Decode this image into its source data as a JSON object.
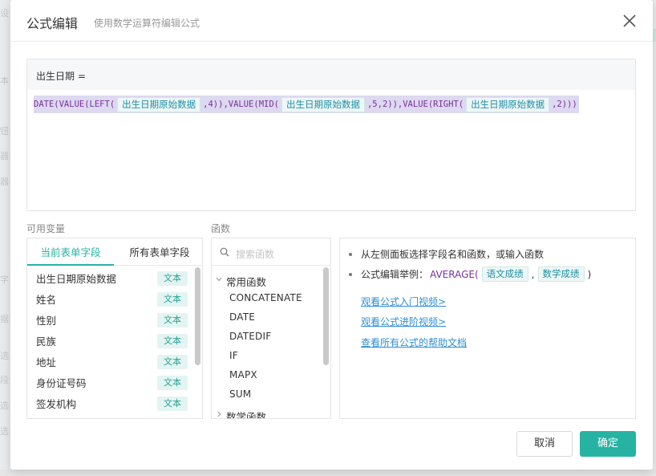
{
  "background": {
    "left_fragments": [
      "设",
      "本",
      "钮",
      "器",
      "器",
      "字",
      "据",
      "选",
      "段",
      "选",
      "选"
    ]
  },
  "dialog": {
    "title": "公式编辑",
    "subtitle": "使用数学运算符编辑公式",
    "close_icon": "close-icon"
  },
  "editor": {
    "field_label": "出生日期 =",
    "formula": [
      {
        "type": "fn",
        "text": "DATE(VALUE(LEFT("
      },
      {
        "type": "field",
        "text": "出生日期原始数据"
      },
      {
        "type": "fn",
        "text": ",4)),VALUE(MID("
      },
      {
        "type": "field",
        "text": "出生日期原始数据"
      },
      {
        "type": "fn",
        "text": ",5,2)),VALUE(RIGHT("
      },
      {
        "type": "field",
        "text": "出生日期原始数据"
      },
      {
        "type": "fn",
        "text": ",2)))"
      }
    ]
  },
  "variables": {
    "label": "可用变量",
    "tabs": [
      {
        "label": "当前表单字段",
        "active": true
      },
      {
        "label": "所有表单字段",
        "active": false
      }
    ],
    "items": [
      {
        "name": "出生日期原始数据",
        "type": "文本"
      },
      {
        "name": "姓名",
        "type": "文本"
      },
      {
        "name": "性别",
        "type": "文本"
      },
      {
        "name": "民族",
        "type": "文本"
      },
      {
        "name": "地址",
        "type": "文本"
      },
      {
        "name": "身份证号码",
        "type": "文本"
      },
      {
        "name": "签发机构",
        "type": "文本"
      }
    ]
  },
  "functions": {
    "label": "函数",
    "search_placeholder": "搜索函数",
    "groups": [
      {
        "name": "常用函数",
        "expanded": true,
        "items": [
          "CONCATENATE",
          "DATE",
          "DATEDIF",
          "IF",
          "MAPX",
          "SUM"
        ]
      },
      {
        "name": "数学函数",
        "expanded": false,
        "items": []
      }
    ]
  },
  "help": {
    "bullet1": "从左侧面板选择字段名和函数，或输入函数",
    "example_prefix": "公式编辑举例：",
    "example_fn": "AVERAGE(",
    "example_field1": "语文成绩",
    "example_sep": ",",
    "example_field2": "数学成绩",
    "example_close": ")",
    "links": [
      "观看公式入门视频>",
      "观看公式进阶视频>",
      "查看所有公式的帮助文档"
    ]
  },
  "footer": {
    "cancel": "取消",
    "ok": "确定"
  },
  "colors": {
    "accent": "#26b3a3",
    "link": "#2e8fd6",
    "function_text": "#7a2f9e",
    "field_text": "#1e8fa6"
  }
}
